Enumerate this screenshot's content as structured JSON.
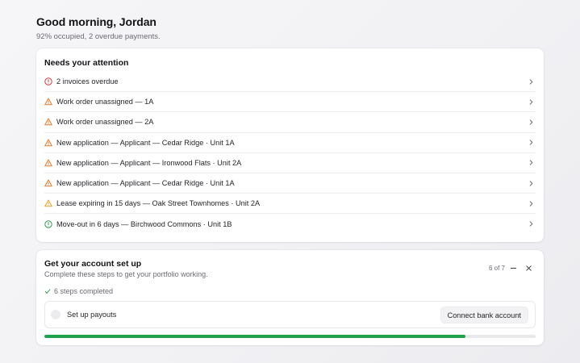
{
  "greeting": {
    "title": "Good morning, Jordan",
    "subtitle": "92% occupied, 2 overdue payments."
  },
  "attention": {
    "title": "Needs your attention",
    "items": [
      {
        "label": "2 invoices overdue",
        "icon": "alert-circle-icon",
        "color": "#d23a3a"
      },
      {
        "label": "Work order unassigned — 1A",
        "icon": "warning-triangle-icon",
        "color": "#e97a2b"
      },
      {
        "label": "Work order unassigned — 2A",
        "icon": "warning-triangle-icon",
        "color": "#e97a2b"
      },
      {
        "label": "New application — Applicant — Cedar Ridge · Unit 1A",
        "icon": "warning-triangle-icon",
        "color": "#e97a2b"
      },
      {
        "label": "New application — Applicant — Ironwood Flats · Unit 2A",
        "icon": "warning-triangle-icon",
        "color": "#e97a2b"
      },
      {
        "label": "New application — Applicant — Cedar Ridge · Unit 1A",
        "icon": "warning-triangle-icon",
        "color": "#e97a2b"
      },
      {
        "label": "Lease expiring in 15 days — Oak Street Townhomes · Unit 2A",
        "icon": "warning-triangle-icon",
        "color": "#e5a52a"
      },
      {
        "label": "Move-out in 6 days — Birchwood Commons · Unit 1B",
        "icon": "info-circle-icon",
        "color": "#2f9a4e"
      }
    ]
  },
  "setup": {
    "title": "Get your account set up",
    "subtitle": "Complete these steps to get your portfolio working.",
    "step_count": "6 of 7",
    "completed_label": "6 steps completed",
    "current_step": {
      "label": "Set up payouts",
      "action_label": "Connect bank account"
    },
    "progress_fraction": 0.857,
    "progress_color": "#1fa34a"
  }
}
